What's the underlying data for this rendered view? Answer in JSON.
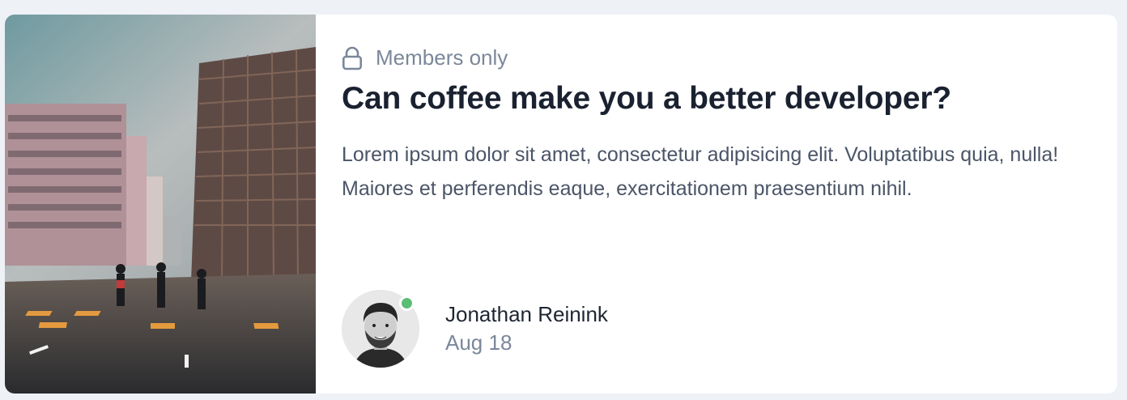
{
  "post": {
    "badge_icon": "lock-icon",
    "badge_label": "Members only",
    "title": "Can coffee make you a better developer?",
    "description": "Lorem ipsum dolor sit amet, consectetur adipisicing elit. Voluptatibus quia, nulla! Maiores et perferendis eaque, exercitationem praesentium nihil.",
    "image_alt": "City street crossing with pedestrians and tall buildings"
  },
  "author": {
    "name": "Jonathan Reinink",
    "date": "Aug 18",
    "status": "online",
    "status_color": "#5cbd75"
  },
  "colors": {
    "page_background": "#eef1f6",
    "title": "#1a2130",
    "muted": "#7b879a",
    "body_text": "#4b5567"
  }
}
